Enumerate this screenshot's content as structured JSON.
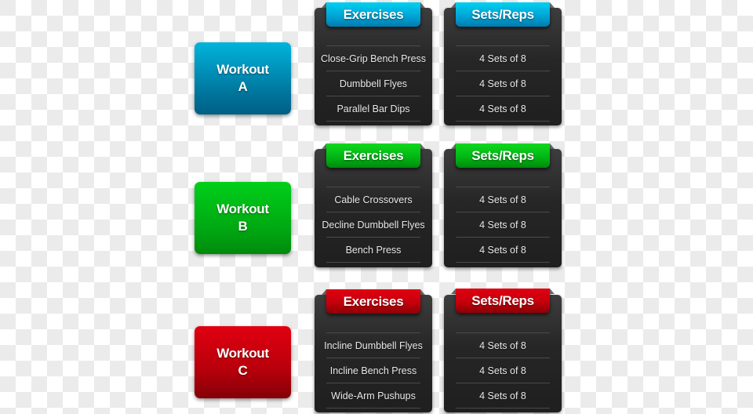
{
  "workouts": [
    {
      "title": "Workout",
      "letter": "A",
      "color": "#0088b8",
      "exercises_header": "Exercises",
      "sets_header": "Sets/Reps",
      "exercises": [
        "Close-Grip Bench Press",
        "Dumbbell Flyes",
        "Parallel Bar Dips"
      ],
      "sets": [
        "4 Sets of 8",
        "4 Sets of 8",
        "4 Sets of 8"
      ]
    },
    {
      "title": "Workout",
      "letter": "B",
      "color": "#00b814",
      "exercises_header": "Exercises",
      "sets_header": "Sets/Reps",
      "exercises": [
        "Cable Crossovers",
        "Decline Dumbbell Flyes",
        "Bench Press"
      ],
      "sets": [
        "4 Sets of 8",
        "4 Sets of 8",
        "4 Sets of 8"
      ]
    },
    {
      "title": "Workout",
      "letter": "C",
      "color": "#c0000c",
      "exercises_header": "Exercises",
      "sets_header": "Sets/Reps",
      "exercises": [
        "Incline Dumbbell Flyes",
        "Incline Bench Press",
        "Wide-Arm Pushups"
      ],
      "sets": [
        "4 Sets of 8",
        "4 Sets of 8",
        "4 Sets of 8"
      ]
    }
  ]
}
